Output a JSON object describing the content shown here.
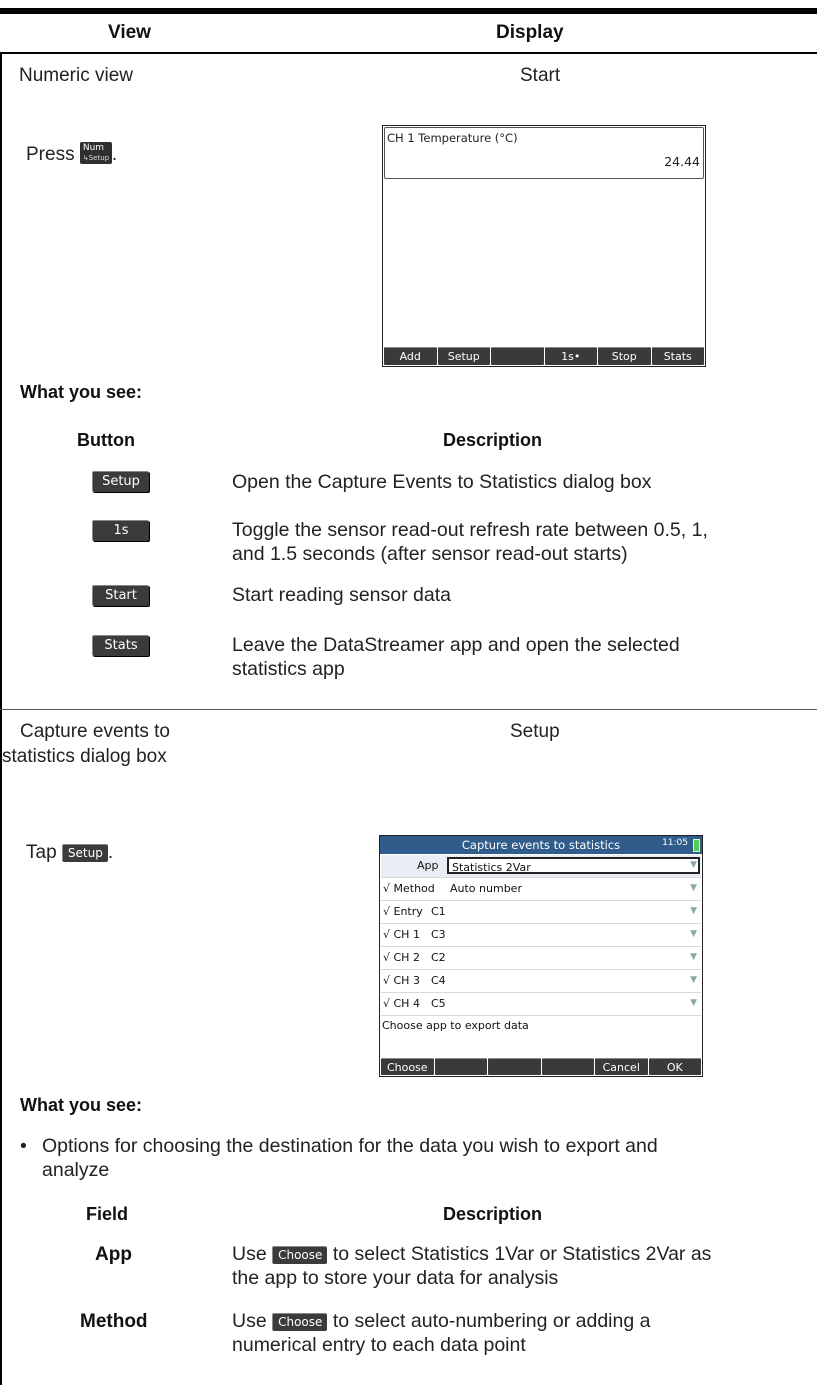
{
  "table_header": {
    "col1": "View",
    "col2": "Display"
  },
  "section1": {
    "view_title": "Numeric view",
    "display_title": "Start",
    "instruction_prefix": "Press",
    "instruction_suffix": ".",
    "key": {
      "top": "Num",
      "bottom": "↳Setup"
    },
    "screen": {
      "channel_label": "CH 1 Temperature (°C)",
      "reading": "24.44",
      "softkeys": [
        "Add",
        "Setup",
        "",
        "1s•",
        "Stop",
        "Stats"
      ]
    },
    "what_you_see": "What you see:",
    "col_headers": {
      "button": "Button",
      "description": "Description"
    },
    "rows": [
      {
        "button": "Setup",
        "desc_lines": [
          "Open the Capture Events to Statistics dialog box"
        ]
      },
      {
        "button": "1s",
        "desc_lines": [
          "Toggle the sensor read-out refresh rate between 0.5, 1,",
          "and 1.5 seconds (after sensor read-out starts)"
        ]
      },
      {
        "button": "Start",
        "desc_lines": [
          "Start reading sensor data"
        ]
      },
      {
        "button": "Stats",
        "desc_lines": [
          "Leave the DataStreamer app and open the selected",
          "statistics app"
        ]
      }
    ]
  },
  "section2": {
    "view_title_lines": [
      "Capture events to",
      "statistics dialog box"
    ],
    "display_title": "Setup",
    "instruction_prefix": "Tap",
    "instruction_button": "Setup",
    "instruction_suffix": ".",
    "screen": {
      "title": "Capture events to statistics",
      "time": "11:05",
      "rows": [
        {
          "label": "App",
          "value": "Statistics 2Var"
        },
        {
          "label": "√ Method",
          "value": "Auto number"
        },
        {
          "label": "√ Entry",
          "value": "C1"
        },
        {
          "label": "√ CH 1",
          "value": "C3"
        },
        {
          "label": "√ CH 2",
          "value": "C2"
        },
        {
          "label": "√ CH 3",
          "value": "C4"
        },
        {
          "label": "√ CH 4",
          "value": "C5"
        }
      ],
      "help": "Choose app to export data",
      "softkeys": [
        "Choose",
        "",
        "",
        "",
        "Cancel",
        "OK"
      ]
    },
    "what_you_see": "What you see:",
    "bullet_lines": [
      "Options for choosing the destination for the data you wish to export and",
      "analyze"
    ],
    "col_headers": {
      "field": "Field",
      "description": "Description"
    },
    "rows": [
      {
        "field": "App",
        "prefix": "Use",
        "button": "Choose",
        "line1_rest": "to select Statistics 1Var or Statistics 2Var as",
        "line2": "the app to store your data for analysis"
      },
      {
        "field": "Method",
        "prefix": "Use",
        "button": "Choose",
        "line1_rest": "to select auto-numbering or adding a",
        "line2": "numerical entry to each data point"
      }
    ]
  }
}
